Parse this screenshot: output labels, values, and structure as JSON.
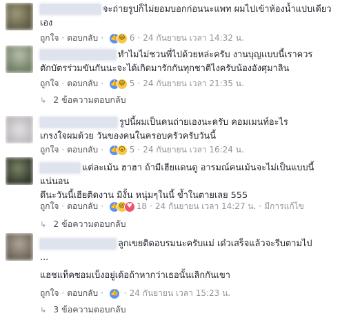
{
  "comments": [
    {
      "text_lines": [
        "จะถ่ายรูปก็ไม่ยอมบอกก่อนนะแพท ผมไปเข้าห้องน้ำแปบเดียว",
        "เอง"
      ],
      "like": "ถูกใจ",
      "reply": "ตอบกลับ",
      "reaction_count": "6",
      "time": "24 กันยายน เวลา 14:32 น.",
      "edited": "",
      "avatar_color": "#6f6a52"
    },
    {
      "text_lines": [
        "ทำไมไม่ชวนพี่ไปด้วยหล่ะครับ งานบุญแบบนี้เราควร",
        "ตักบัตรร่วมขันกันนะจะได้เกิดมารักกันทุกชาติไงครับน้องอังศุมาลิน"
      ],
      "like": "ถูกใจ",
      "reply": "ตอบกลับ",
      "reaction_count": "5",
      "time": "24 กันยายน เวลา 21:35 น.",
      "edited": "",
      "replies_label": "2 ข้อความตอบกลับ",
      "avatar_color": "#7d8b73"
    },
    {
      "text_lines": [
        "รูปนี้ผมเป็นคนถ่ายเองนะครับ คอมเมนท์อะไร",
        "เกรงใจผมด้วย วันของคนในครอบครัวครับวันนี้"
      ],
      "like": "ถูกใจ",
      "reply": "ตอบกลับ",
      "reaction_count": "5",
      "time": "24 กันยายน เวลา 16:24 น.",
      "edited": "",
      "avatar_color": "#c9c6c9"
    },
    {
      "text_lines": [
        "แต่ละเม้น ฮาฮา ถ้ามีเฮียแดนดู อารมณ์คนเม้นจะไม่เป็นแบบนี้",
        "แน่นอน",
        "ดึนะวันนี้เฮียติดงาน มิงั้น หนุ่มๆในนี้ ข้ำในตายเลย 555"
      ],
      "like": "ถูกใจ",
      "reply": "ตอบกลับ",
      "reaction_count": "18",
      "time": "24 กันยายน เวลา 14:27 น.",
      "edited": "มีการแก้ไข",
      "replies_label": "2 ข้อความตอบกลับ",
      "avatar_color": "#3f4637"
    },
    {
      "text_lines": [
        "ลูกเขยติดอบรมนะครับแม่ เด๋วเสร็จแล้วจะรีบตามไป",
        "...",
        "แฮชแท็คซอมเบ็งอยู่เด้อถ้าหากว่าเธอนั้นเลิกกันเขา"
      ],
      "like": "ถูกใจ",
      "reply": "ตอบกลับ",
      "reaction_count": "",
      "time": "24 กันยายน เวลา 15:23 น.",
      "edited": "",
      "replies_label": "3 ข้อความตอบกลับ",
      "avatar_color": "#7a7266"
    }
  ],
  "colors": {
    "link": "#4b4f56",
    "meta": "#90949c",
    "like_reaction": "#5890ff",
    "haha_reaction": "#f7c843",
    "love_reaction": "#f25268"
  },
  "icons": [
    "like-reaction-icon",
    "haha-reaction-icon",
    "wow-reaction-icon",
    "love-reaction-icon",
    "reply-arrow-icon"
  ]
}
